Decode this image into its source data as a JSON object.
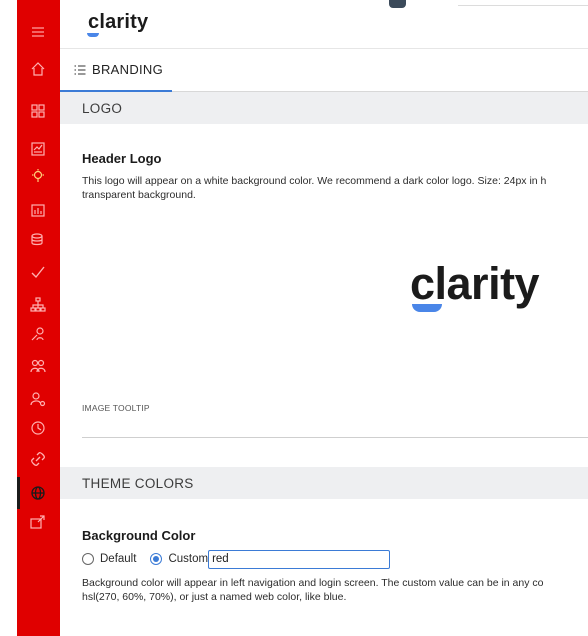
{
  "header": {
    "logo_text": "clarity"
  },
  "subnav": {
    "tab_label": "BRANDING"
  },
  "sections": {
    "logo": {
      "title": "LOGO",
      "header_logo_title": "Header Logo",
      "header_logo_desc_line1": "This logo will appear on a white background color. We recommend a dark color logo. Size: 24px in h",
      "header_logo_desc_line2": "transparent background.",
      "preview_logo_text": "clarity",
      "image_tooltip_label": "IMAGE TOOLTIP",
      "image_tooltip_value": ""
    },
    "theme_colors": {
      "title": "THEME COLORS",
      "bg_color_title": "Background Color",
      "option_default": "Default",
      "option_custom": "Custom",
      "custom_value": "red",
      "bg_color_desc_line1": "Background color will appear in left navigation and login screen. The custom value can be in any co",
      "bg_color_desc_line2": "hsl(270, 60%, 70%), or just a named web color, like blue."
    }
  },
  "colors": {
    "nav_background": "#e00000",
    "accent": "#3b7bd6",
    "logo_swoosh": "#4a86e8",
    "section_bar": "#eeeff1"
  },
  "nav": {
    "icons": [
      "menu-icon",
      "home-icon",
      "dashboard-icon",
      "reports-icon",
      "insights-icon",
      "analytics-icon",
      "database-icon",
      "check-icon",
      "hierarchy-icon",
      "user-search-icon",
      "users-icon",
      "user-settings-icon",
      "clock-icon",
      "link-icon",
      "globe-settings-icon",
      "export-icon"
    ],
    "active_item": "globe-settings-icon"
  }
}
